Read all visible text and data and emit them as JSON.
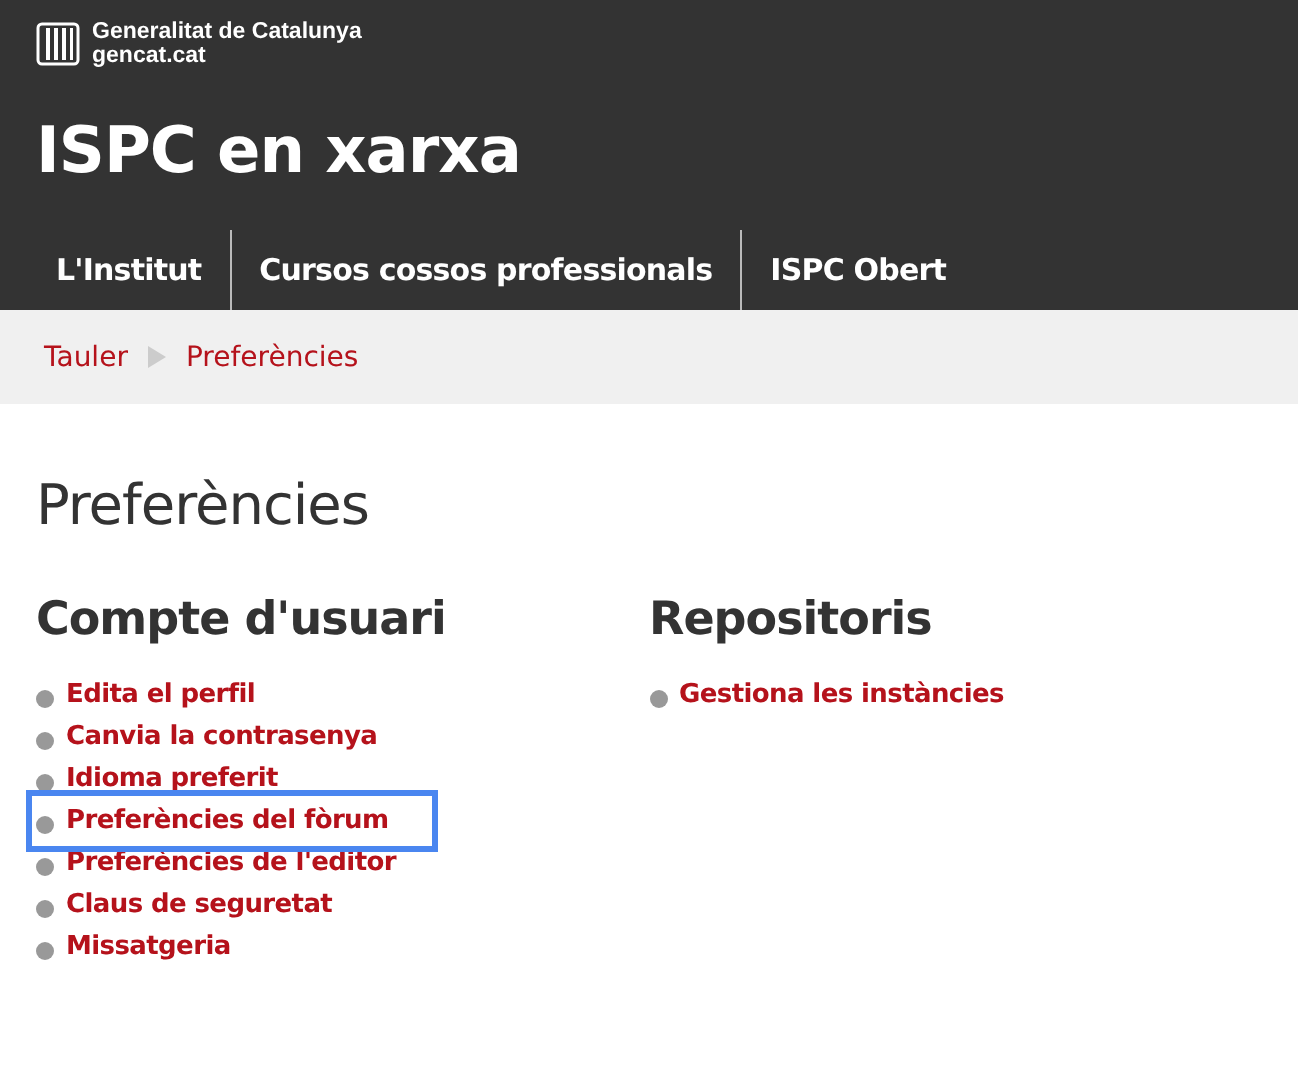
{
  "brand": {
    "name": "Generalitat de Catalunya",
    "site": "gencat.cat"
  },
  "site_title": "ISPC en xarxa",
  "nav": [
    {
      "label": "L'Institut"
    },
    {
      "label": "Cursos cossos professionals"
    },
    {
      "label": "ISPC Obert"
    }
  ],
  "breadcrumb": [
    {
      "label": "Tauler"
    },
    {
      "label": "Preferències"
    }
  ],
  "page_title": "Preferències",
  "sections": [
    {
      "title": "Compte d'usuari",
      "links": [
        {
          "label": "Edita el perfil",
          "highlighted": false
        },
        {
          "label": "Canvia la contrasenya",
          "highlighted": false
        },
        {
          "label": "Idioma preferit",
          "highlighted": false
        },
        {
          "label": "Preferències del fòrum",
          "highlighted": true
        },
        {
          "label": "Preferències de l'editor",
          "highlighted": false
        },
        {
          "label": "Claus de seguretat",
          "highlighted": false
        },
        {
          "label": "Missatgeria",
          "highlighted": false
        }
      ]
    },
    {
      "title": "Repositoris",
      "links": [
        {
          "label": "Gestiona les instàncies",
          "highlighted": false
        }
      ]
    }
  ]
}
